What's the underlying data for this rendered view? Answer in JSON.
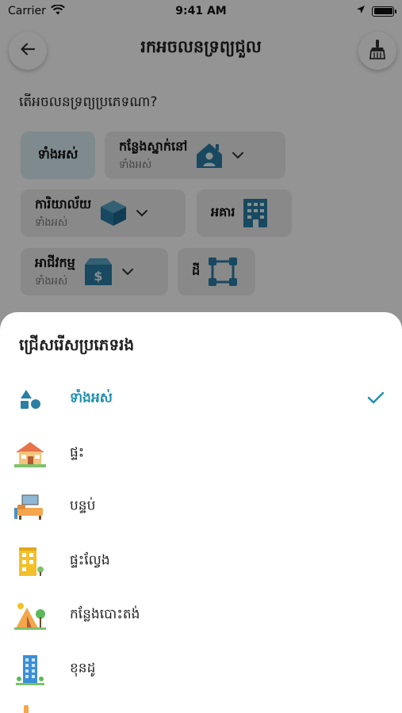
{
  "status_bar": {
    "carrier": "Carrier",
    "time": "9:41 AM"
  },
  "header": {
    "title": "រកអចលនទ្រព្យជួល",
    "back_icon": "arrow-left-icon",
    "clear_icon": "broom-icon"
  },
  "question": "តើអចលនទ្រព្យប្រភេទណា?",
  "filters": {
    "all": {
      "label": "ទាំងអស់"
    },
    "residence": {
      "label": "កន្លែងស្នាក់នៅ",
      "sub": "ទាំងអស់"
    },
    "office": {
      "label": "ការិយាល័យ",
      "sub": "ទាំងអស់"
    },
    "building": {
      "label": "អគារ"
    },
    "business": {
      "label": "អាជីវកម្ម",
      "sub": "ទាំងអស់"
    },
    "land": {
      "label": "ដី"
    }
  },
  "sheet": {
    "title": "ជ្រើសរើសប្រភេទរង",
    "options": [
      {
        "label": "ទាំងអស់",
        "icon": "shapes-icon",
        "selected": true
      },
      {
        "label": "ផ្ទះ",
        "icon": "house-icon",
        "selected": false
      },
      {
        "label": "បន្ទប់",
        "icon": "room-icon",
        "selected": false
      },
      {
        "label": "ផ្ទះល្វែង",
        "icon": "shophouse-icon",
        "selected": false
      },
      {
        "label": "កន្លែងបោះតង់",
        "icon": "camping-tent-icon",
        "selected": false
      },
      {
        "label": "ខុនដូ",
        "icon": "condo-building-icon",
        "selected": false
      }
    ]
  },
  "colors": {
    "accent": "#1e8fb0",
    "icon_teal": "#2a7fa6",
    "chip_bg": "#ececec",
    "chip_selected_bg": "#d9eef5"
  }
}
